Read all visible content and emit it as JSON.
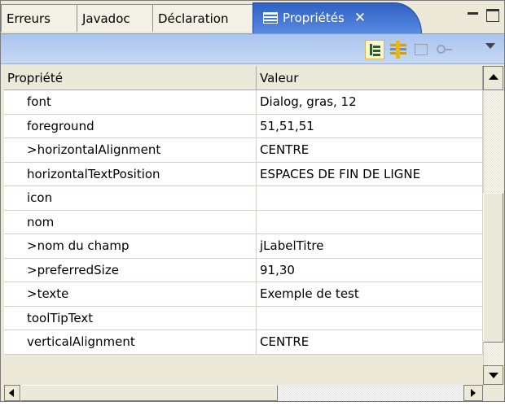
{
  "tabs": [
    {
      "label": "Erreurs"
    },
    {
      "label": "Javadoc"
    },
    {
      "label": "Déclaration"
    },
    {
      "label": "Propriétés",
      "active": true
    }
  ],
  "icons": {
    "active_tab": "properties-view-icon",
    "close": "close-icon",
    "minimize": "minimize-icon",
    "maximize": "maximize-icon",
    "toolbar": [
      "show-categories-icon",
      "show-advanced-icon",
      "restore-default-icon",
      "link-icon",
      "view-menu-icon"
    ]
  },
  "colors": {
    "active_tab": "#3a6bd0",
    "toolbar": "#b8cff2",
    "panel": "#ece9d8"
  },
  "table": {
    "columns": [
      "Propriété",
      "Valeur"
    ],
    "rows": [
      {
        "property": "font",
        "value": "Dialog, gras, 12"
      },
      {
        "property": "foreground",
        "value": "51,51,51"
      },
      {
        "property": ">horizontalAlignment",
        "value": "CENTRE"
      },
      {
        "property": "horizontalTextPosition",
        "value": "ESPACES DE FIN DE LIGNE"
      },
      {
        "property": "icon",
        "value": ""
      },
      {
        "property": "nom",
        "value": ""
      },
      {
        "property": ">nom du champ",
        "value": "jLabelTitre"
      },
      {
        "property": ">preferredSize",
        "value": "91,30"
      },
      {
        "property": ">texte",
        "value": "Exemple de test"
      },
      {
        "property": "toolTipText",
        "value": ""
      },
      {
        "property": "verticalAlignment",
        "value": "CENTRE"
      }
    ]
  }
}
